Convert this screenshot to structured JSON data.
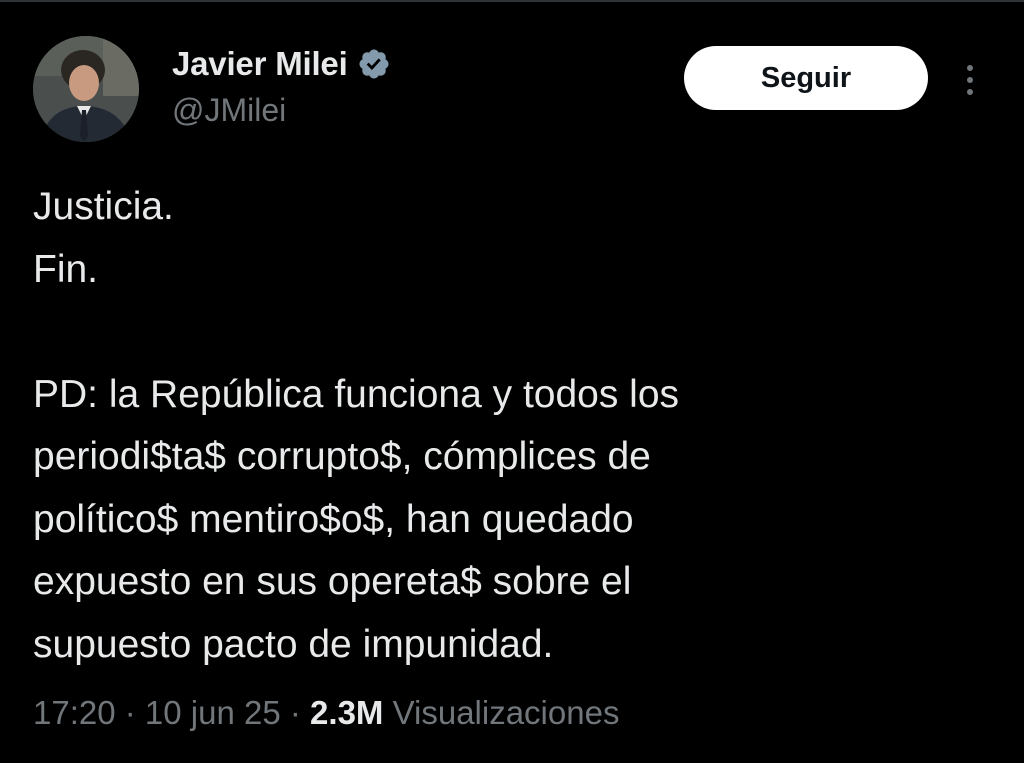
{
  "author": {
    "display_name": "Javier Milei",
    "handle": "@JMilei",
    "verified_color": "#829aab"
  },
  "actions": {
    "follow_label": "Seguir"
  },
  "tweet": {
    "lines": [
      "Justicia.",
      "Fin.",
      "",
      "PD: la República funciona y todos los",
      "periodi$ta$ corrupto$, cómplices de",
      "político$ mentiro$o$, han quedado",
      "expuesto en sus opereta$ sobre el",
      "supuesto pacto de impunidad."
    ]
  },
  "meta": {
    "time": "17:20",
    "separator": " · ",
    "date": "10 jun 25",
    "views_count": "2.3M",
    "views_label": "Visualizaciones"
  },
  "colors": {
    "background": "#000000",
    "text_primary": "#e7e9ea",
    "text_secondary": "#71767b",
    "button_bg": "#ffffff",
    "button_text": "#0f1419"
  }
}
